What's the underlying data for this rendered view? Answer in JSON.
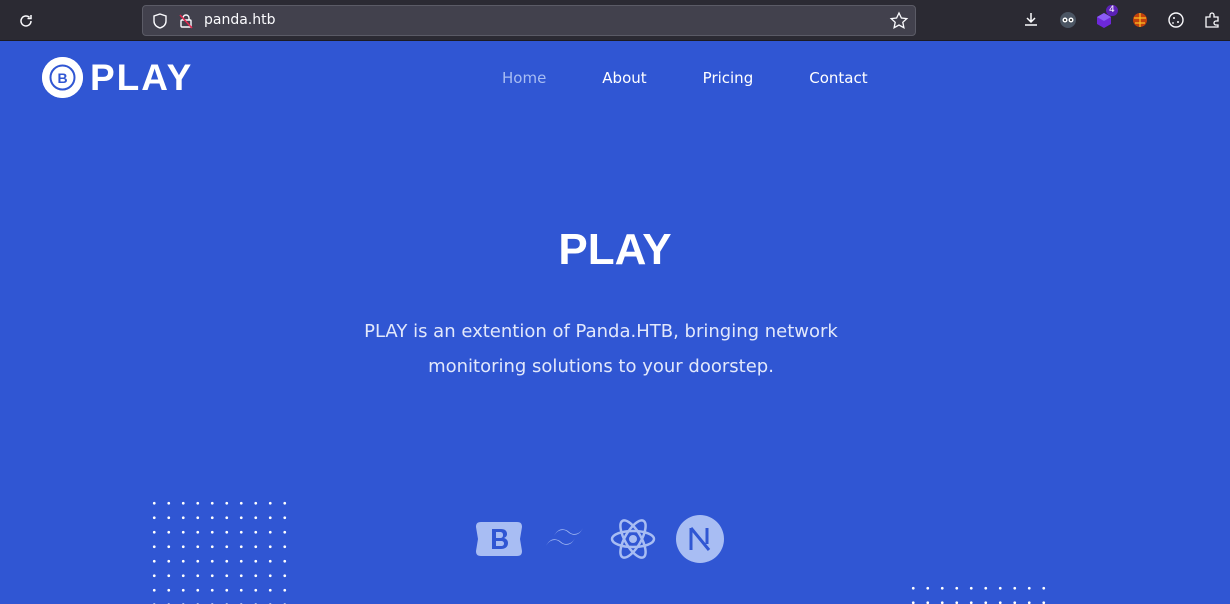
{
  "browser": {
    "url": "panda.htb",
    "extension_badge": "4"
  },
  "site": {
    "logo_letter": "B",
    "logo_text": "PLAY",
    "nav": [
      {
        "label": "Home",
        "active": true
      },
      {
        "label": "About",
        "active": false
      },
      {
        "label": "Pricing",
        "active": false
      },
      {
        "label": "Contact",
        "active": false
      }
    ]
  },
  "hero": {
    "title": "PLAY",
    "description": "PLAY is an extention of Panda.HTB, bringing network monitoring solutions to your doorstep."
  },
  "tech_icons": [
    "bootstrap-icon",
    "tailwind-icon",
    "react-icon",
    "nextjs-icon"
  ],
  "colors": {
    "background": "#3056d3",
    "chrome": "#2b2a33",
    "nav_active": "#a8bdf3",
    "icon_tint": "#a8bdf3"
  }
}
